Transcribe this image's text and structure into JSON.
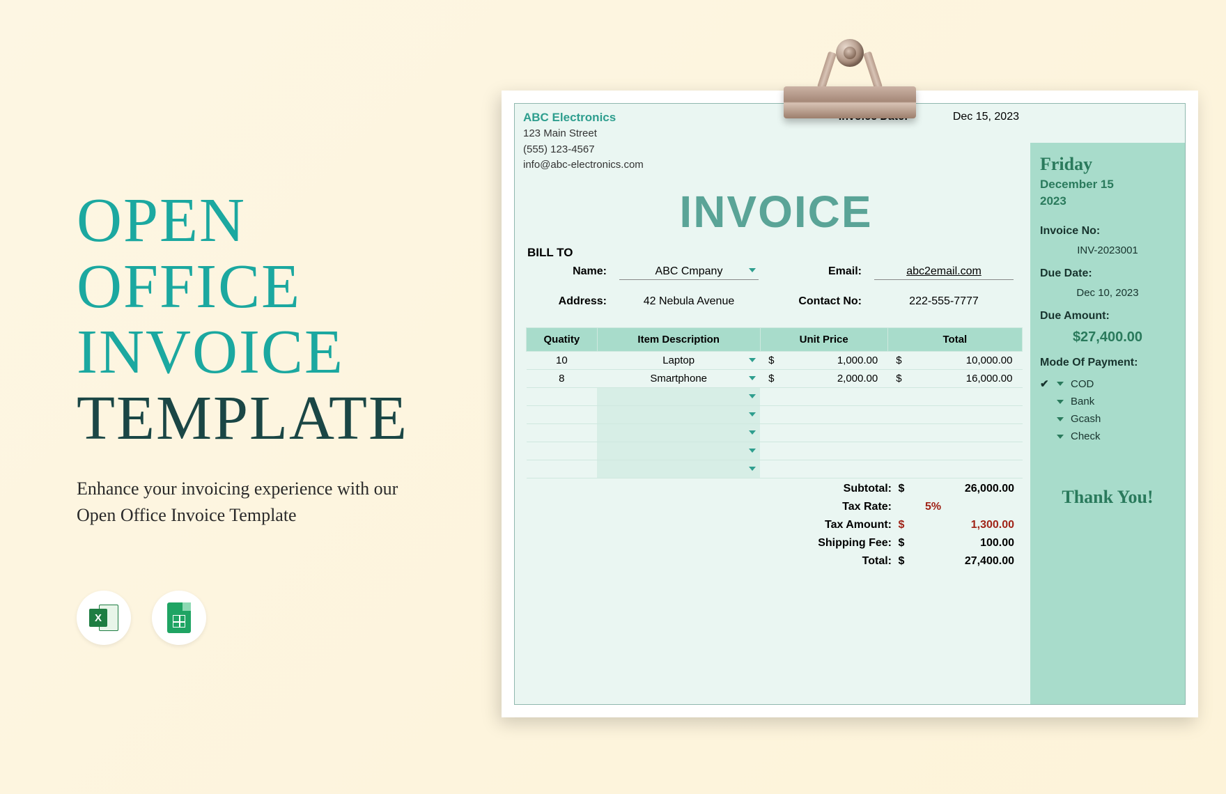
{
  "promo": {
    "title_line1": "OPEN",
    "title_line2": "OFFICE",
    "title_line3": "INVOICE",
    "title_line4": "TEMPLATE",
    "subtitle": "Enhance your invoicing experience with our Open Office Invoice Template"
  },
  "company": {
    "name": "ABC Electronics",
    "street": "123 Main Street",
    "phone": "(555) 123-4567",
    "email": "info@abc-electronics.com"
  },
  "invoice_header": {
    "date_label": "Invoice Date:",
    "date_value": "Dec 15, 2023",
    "big_title": "INVOICE"
  },
  "bill_to": {
    "heading": "BILL TO",
    "name_label": "Name:",
    "name_value": "ABC Cmpany",
    "email_label": "Email:",
    "email_value": "abc2email.com",
    "address_label": "Address:",
    "address_value": "42 Nebula Avenue",
    "contact_label": "Contact No:",
    "contact_value": "222-555-7777"
  },
  "columns": {
    "qty": "Quatity",
    "desc": "Item Description",
    "unit": "Unit Price",
    "total": "Total"
  },
  "items": [
    {
      "qty": "10",
      "desc": "Laptop",
      "unit": "1,000.00",
      "total": "10,000.00"
    },
    {
      "qty": "8",
      "desc": "Smartphone",
      "unit": "2,000.00",
      "total": "16,000.00"
    }
  ],
  "totals": {
    "subtotal_label": "Subtotal:",
    "subtotal": "26,000.00",
    "taxrate_label": "Tax Rate:",
    "taxrate": "5%",
    "taxamt_label": "Tax Amount:",
    "taxamt": "1,300.00",
    "ship_label": "Shipping Fee:",
    "ship": "100.00",
    "total_label": "Total:",
    "total": "27,400.00",
    "dollar": "$"
  },
  "side": {
    "day": "Friday",
    "date": "December 15",
    "year": "2023",
    "invno_label": "Invoice No:",
    "invno": "INV-2023001",
    "duedate_label": "Due Date:",
    "duedate": "Dec 10, 2023",
    "dueamt_label": "Due Amount:",
    "dueamt": "$27,400.00",
    "mode_label": "Mode Of Payment:",
    "payments": [
      {
        "checked": "✔",
        "label": "COD"
      },
      {
        "checked": "",
        "label": "Bank"
      },
      {
        "checked": "",
        "label": "Gcash"
      },
      {
        "checked": "",
        "label": "Check"
      }
    ],
    "thanks": "Thank You!"
  }
}
